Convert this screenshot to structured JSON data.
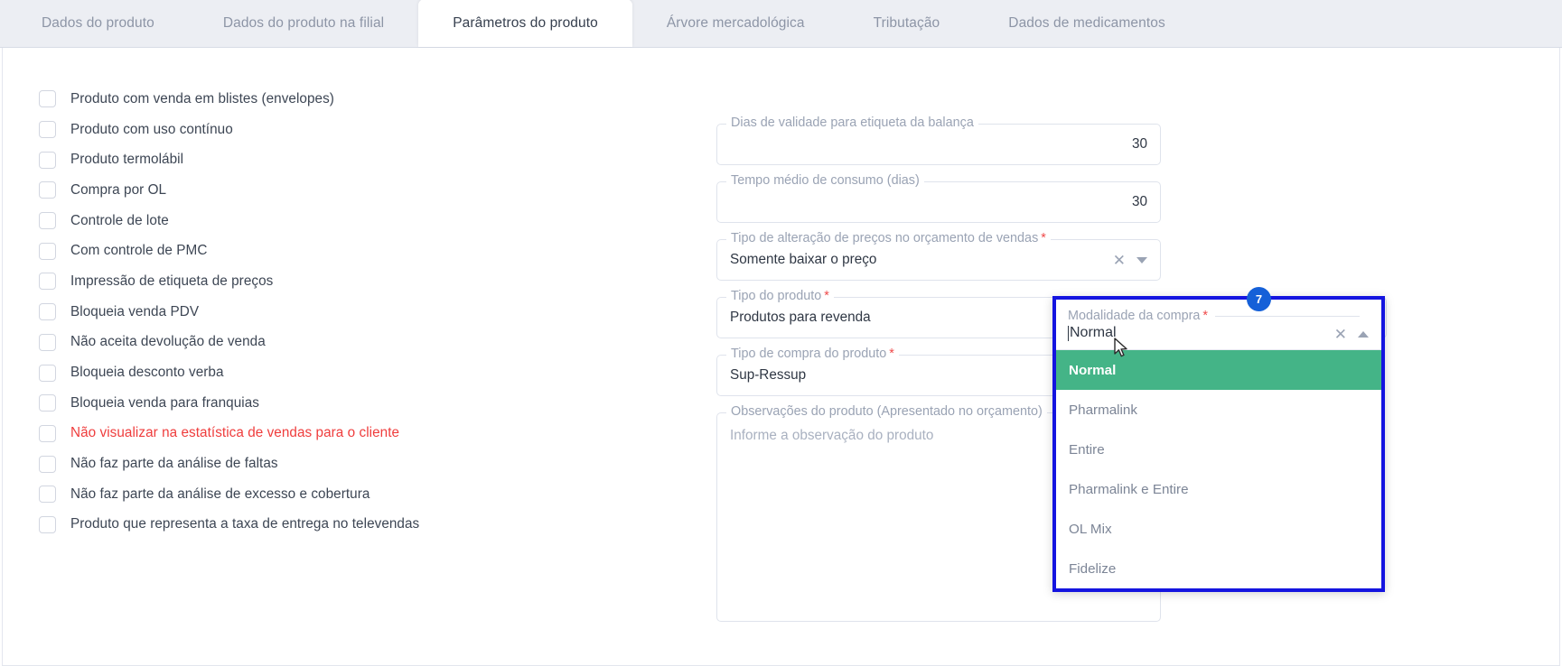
{
  "tabs": [
    {
      "label": "Dados do produto",
      "active": false
    },
    {
      "label": "Dados do produto na filial",
      "active": false
    },
    {
      "label": "Parâmetros do produto",
      "active": true
    },
    {
      "label": "Árvore mercadológica",
      "active": false
    },
    {
      "label": "Tributação",
      "active": false
    },
    {
      "label": "Dados de medicamentos",
      "active": false
    }
  ],
  "checkboxes": [
    {
      "label": "Produto com venda em blistes (envelopes)",
      "checked": false,
      "danger": false
    },
    {
      "label": "Produto com uso contínuo",
      "checked": false,
      "danger": false
    },
    {
      "label": "Produto termolábil",
      "checked": false,
      "danger": false
    },
    {
      "label": "Compra por OL",
      "checked": false,
      "danger": false
    },
    {
      "label": "Controle de lote",
      "checked": false,
      "danger": false
    },
    {
      "label": "Com controle de PMC",
      "checked": false,
      "danger": false
    },
    {
      "label": "Impressão de etiqueta de preços",
      "checked": false,
      "danger": false
    },
    {
      "label": "Bloqueia venda PDV",
      "checked": false,
      "danger": false
    },
    {
      "label": "Não aceita devolução de venda",
      "checked": false,
      "danger": false
    },
    {
      "label": "Bloqueia desconto verba",
      "checked": false,
      "danger": false
    },
    {
      "label": "Bloqueia venda para franquias",
      "checked": false,
      "danger": false
    },
    {
      "label": "Não visualizar na estatística de vendas para o cliente",
      "checked": false,
      "danger": true
    },
    {
      "label": "Não faz parte da análise de faltas",
      "checked": false,
      "danger": false
    },
    {
      "label": "Não faz parte da análise de excesso e cobertura",
      "checked": false,
      "danger": false
    },
    {
      "label": "Produto que representa a taxa de entrega no televendas",
      "checked": false,
      "danger": false
    }
  ],
  "fields": {
    "dias_validade": {
      "label": "Dias de validade para etiqueta da balança",
      "value": "30",
      "required": false
    },
    "tempo_medio": {
      "label": "Tempo médio de consumo (dias)",
      "value": "30",
      "required": false
    },
    "tipo_alteracao": {
      "label": "Tipo de alteração de preços no orçamento de vendas",
      "value": "Somente baixar o preço",
      "required": true
    },
    "tipo_produto": {
      "label": "Tipo do produto",
      "value": "Produtos para revenda",
      "required": true
    },
    "tipo_compra": {
      "label": "Tipo de compra do produto",
      "value": "Sup-Ressup",
      "required": true
    },
    "observacoes": {
      "label": "Observações do produto (Apresentado no orçamento)",
      "value": "",
      "placeholder": "Informe a observação do produto",
      "required": false
    }
  },
  "callout": {
    "badge": "7",
    "label": "Modalidade da compra",
    "required": true,
    "value": "Normal",
    "clear_icon": "close-icon",
    "caret_icon": "chevron-up-icon",
    "options": [
      {
        "label": "Normal",
        "selected": true
      },
      {
        "label": "Pharmalink",
        "selected": false
      },
      {
        "label": "Entire",
        "selected": false
      },
      {
        "label": "Pharmalink e Entire",
        "selected": false
      },
      {
        "label": "OL Mix",
        "selected": false
      },
      {
        "label": "Fidelize",
        "selected": false
      }
    ]
  },
  "icons": {
    "clear": "✕"
  },
  "colors": {
    "tab_active_text": "#37404f",
    "tab_inactive_text": "#8d95a6",
    "tabstrip_bg": "#eceef3",
    "danger": "#ef3d3d",
    "required_star": "#ef4a4a",
    "callout_border": "#1414e0",
    "badge_bg": "#1560d8",
    "option_selected_bg": "#44b487",
    "label_text": "#9aa3b4",
    "value_text": "#2f3744"
  }
}
